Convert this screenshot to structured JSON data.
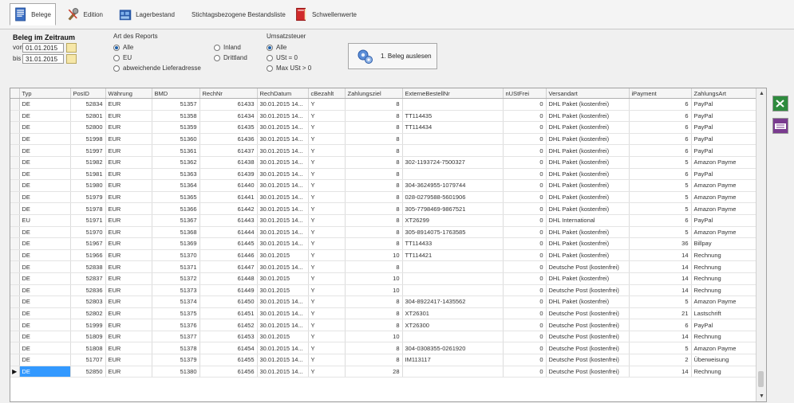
{
  "toolbar": {
    "tabs": [
      {
        "label": "Belege",
        "icon": "document-icon"
      },
      {
        "label": "Edition",
        "icon": "tools-icon"
      },
      {
        "label": "Lagerbestand",
        "icon": "warehouse-icon"
      },
      {
        "label": "Stichtagsbezogene Bestandsliste",
        "icon": "grid-table-icon"
      },
      {
        "label": "Schwellenwerte",
        "icon": "red-book-icon"
      }
    ]
  },
  "filters": {
    "zeitraum_title": "Beleg im Zeitraum",
    "von_label": "von",
    "bis_label": "bis",
    "von_value": "01.01.2015",
    "bis_value": "31.01.2015",
    "report_title": "Art des Reports",
    "report_options": [
      "Alle",
      "EU",
      "abweichende Lieferadresse",
      "Inland",
      "Drittland"
    ],
    "report_selected": "Alle",
    "ust_title": "Umsatzsteuer",
    "ust_options": [
      "Alle",
      "USt = 0",
      "Max USt > 0"
    ],
    "ust_selected": "Alle",
    "action_label": "1. Beleg auslesen"
  },
  "grid": {
    "columns": [
      "Typ",
      "PosID",
      "Währung",
      "BMD",
      "RechNr",
      "RechDatum",
      "cBezahlt",
      "Zahlungsziel",
      "ExterneBestellNr",
      "nUStFrei",
      "Versandart",
      "iPayment",
      "ZahlungsArt"
    ],
    "rows": [
      [
        "DE",
        "52834",
        "EUR",
        "51357",
        "61433",
        "30.01.2015 14...",
        "Y",
        "8",
        "",
        "0",
        "DHL Paket (kostenfrei)",
        "6",
        "PayPal"
      ],
      [
        "DE",
        "52801",
        "EUR",
        "51358",
        "61434",
        "30.01.2015 14...",
        "Y",
        "8",
        "TT114435",
        "0",
        "DHL Paket (kostenfrei)",
        "6",
        "PayPal"
      ],
      [
        "DE",
        "52800",
        "EUR",
        "51359",
        "61435",
        "30.01.2015 14...",
        "Y",
        "8",
        "TT114434",
        "0",
        "DHL Paket (kostenfrei)",
        "6",
        "PayPal"
      ],
      [
        "DE",
        "51998",
        "EUR",
        "51360",
        "61436",
        "30.01.2015 14...",
        "Y",
        "8",
        "",
        "0",
        "DHL Paket (kostenfrei)",
        "6",
        "PayPal"
      ],
      [
        "DE",
        "51997",
        "EUR",
        "51361",
        "61437",
        "30.01.2015 14...",
        "Y",
        "8",
        "",
        "0",
        "DHL Paket (kostenfrei)",
        "6",
        "PayPal"
      ],
      [
        "DE",
        "51982",
        "EUR",
        "51362",
        "61438",
        "30.01.2015 14...",
        "Y",
        "8",
        "302-1193724-7500327",
        "0",
        "DHL Paket (kostenfrei)",
        "5",
        "Amazon Payme"
      ],
      [
        "DE",
        "51981",
        "EUR",
        "51363",
        "61439",
        "30.01.2015 14...",
        "Y",
        "8",
        "",
        "0",
        "DHL Paket (kostenfrei)",
        "6",
        "PayPal"
      ],
      [
        "DE",
        "51980",
        "EUR",
        "51364",
        "61440",
        "30.01.2015 14...",
        "Y",
        "8",
        "304-3624955-1079744",
        "0",
        "DHL Paket (kostenfrei)",
        "5",
        "Amazon Payme"
      ],
      [
        "DE",
        "51979",
        "EUR",
        "51365",
        "61441",
        "30.01.2015 14...",
        "Y",
        "8",
        "028-0279588-5601906",
        "0",
        "DHL Paket (kostenfrei)",
        "5",
        "Amazon Payme"
      ],
      [
        "DE",
        "51978",
        "EUR",
        "51366",
        "61442",
        "30.01.2015 14...",
        "Y",
        "8",
        "305-7798469-9867521",
        "0",
        "DHL Paket (kostenfrei)",
        "5",
        "Amazon Payme"
      ],
      [
        "EU",
        "51971",
        "EUR",
        "51367",
        "61443",
        "30.01.2015 14...",
        "Y",
        "8",
        "XT26299",
        "0",
        "DHL International",
        "6",
        "PayPal"
      ],
      [
        "DE",
        "51970",
        "EUR",
        "51368",
        "61444",
        "30.01.2015 14...",
        "Y",
        "8",
        "305-8914075-1763585",
        "0",
        "DHL Paket (kostenfrei)",
        "5",
        "Amazon Payme"
      ],
      [
        "DE",
        "51967",
        "EUR",
        "51369",
        "61445",
        "30.01.2015 14...",
        "Y",
        "8",
        "TT114433",
        "0",
        "DHL Paket (kostenfrei)",
        "36",
        "Billpay"
      ],
      [
        "DE",
        "51966",
        "EUR",
        "51370",
        "61446",
        "30.01.2015",
        "Y",
        "10",
        "TT114421",
        "0",
        "DHL Paket (kostenfrei)",
        "14",
        "Rechnung"
      ],
      [
        "DE",
        "52838",
        "EUR",
        "51371",
        "61447",
        "30.01.2015 14...",
        "Y",
        "8",
        "",
        "0",
        "Deutsche Post (kostenfrei)",
        "14",
        "Rechnung"
      ],
      [
        "DE",
        "52837",
        "EUR",
        "51372",
        "61448",
        "30.01.2015",
        "Y",
        "10",
        "",
        "0",
        "DHL Paket (kostenfrei)",
        "14",
        "Rechnung"
      ],
      [
        "DE",
        "52836",
        "EUR",
        "51373",
        "61449",
        "30.01.2015",
        "Y",
        "10",
        "",
        "0",
        "Deutsche Post (kostenfrei)",
        "14",
        "Rechnung"
      ],
      [
        "DE",
        "52803",
        "EUR",
        "51374",
        "61450",
        "30.01.2015 14...",
        "Y",
        "8",
        "304-8922417-1435562",
        "0",
        "DHL Paket (kostenfrei)",
        "5",
        "Amazon Payme"
      ],
      [
        "DE",
        "52802",
        "EUR",
        "51375",
        "61451",
        "30.01.2015 14...",
        "Y",
        "8",
        "XT26301",
        "0",
        "Deutsche Post (kostenfrei)",
        "21",
        "Lastschrift"
      ],
      [
        "DE",
        "51999",
        "EUR",
        "51376",
        "61452",
        "30.01.2015 14...",
        "Y",
        "8",
        "XT26300",
        "0",
        "Deutsche Post (kostenfrei)",
        "6",
        "PayPal"
      ],
      [
        "DE",
        "51809",
        "EUR",
        "51377",
        "61453",
        "30.01.2015",
        "Y",
        "10",
        "",
        "0",
        "Deutsche Post (kostenfrei)",
        "14",
        "Rechnung"
      ],
      [
        "DE",
        "51808",
        "EUR",
        "51378",
        "61454",
        "30.01.2015 14...",
        "Y",
        "8",
        "304-0308355-0261920",
        "0",
        "Deutsche Post (kostenfrei)",
        "5",
        "Amazon Payme"
      ],
      [
        "DE",
        "51707",
        "EUR",
        "51379",
        "61455",
        "30.01.2015 14...",
        "Y",
        "8",
        "IM113117",
        "0",
        "Deutsche Post (kostenfrei)",
        "2",
        "Überweisung"
      ],
      [
        "DE",
        "52850",
        "EUR",
        "51380",
        "61456",
        "30.01.2015 14...",
        "Y",
        "28",
        "",
        "0",
        "Deutsche Post (kostenfrei)",
        "14",
        "Rechnung"
      ]
    ],
    "current_row": 23
  },
  "side_buttons": [
    {
      "icon": "excel-export-icon",
      "color": "#2e8b3e"
    },
    {
      "icon": "csv-export-icon",
      "color": "#7a3b8f"
    }
  ],
  "colors": {
    "selection": "#3399ff"
  }
}
